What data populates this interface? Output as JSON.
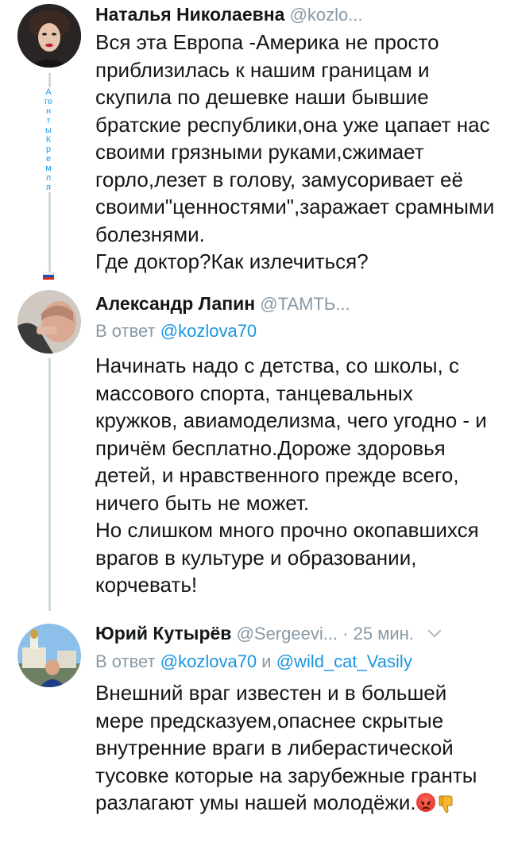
{
  "tweets": [
    {
      "author": "Наталья Николаевна",
      "handle": "@kozlo...",
      "body": [
        "Вся эта Европа -Америка не просто приблизилась к нашим границам и скупила по дешевке наши бывшие братские республики,она уже цапает нас своими грязными руками,сжимает горло,лезет в голову, замусоривает её своими\"ценностями\",заражает срамными болезнями.",
        "Где доктор?Как излечиться?"
      ],
      "sidebar_text": "Агенты Кремля"
    },
    {
      "author": "Александр Лапин",
      "handle": "@TAMTЬ...",
      "reply_prefix": "В ответ",
      "reply_to": "@kozlova70",
      "body": [
        "Начинать надо с детства, со школы, с массового спорта, танцевальных кружков, авиамоделизма, чего угодно - и причём бесплатно.Дороже здоровья детей, и нравственного прежде всего, ничего быть не может.",
        "Но слишком много прочно окопавшихся врагов в культуре и образовании, корчевать!"
      ]
    },
    {
      "author": "Юрий Кутырёв",
      "handle": "@Sergeevi...",
      "dot": "·",
      "time": "25 мин.",
      "reply_prefix": "В ответ",
      "reply_to": "@kozlova70",
      "reply_and": "и",
      "reply_to2": "@wild_cat_Vasily",
      "body": [
        "Внешний враг известен и в большей мере предсказуем,опаснее скрытые внутренние враги в либерастической тусовке которые на зарубежные гранты разлагают умы нашей молодёжи."
      ],
      "emojis": [
        "angry-face",
        "thumbs-down"
      ]
    }
  ],
  "colors": {
    "text": "#14171a",
    "secondary": "#8899a6",
    "link": "#1b95e0",
    "thread_line": "#cfd9de"
  }
}
